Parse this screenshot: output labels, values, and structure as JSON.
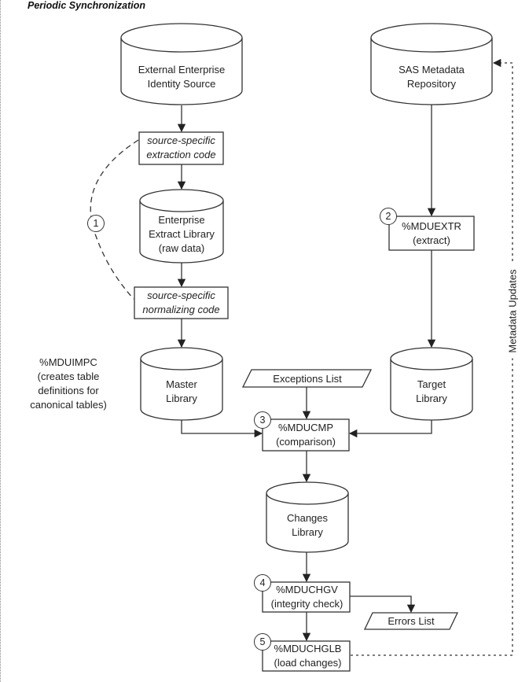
{
  "title": "Periodic Synchronization",
  "nodes": {
    "external_source": {
      "type": "database",
      "label": "External Enterprise\nIdentity Source"
    },
    "sas_repository": {
      "type": "database",
      "label": "SAS Metadata\nRepository"
    },
    "extraction_code": {
      "type": "process",
      "label": "source-specific\nextraction code",
      "style": "italic"
    },
    "extract_library": {
      "type": "database",
      "label": "Enterprise\nExtract Library\n(raw data)"
    },
    "normalizing_code": {
      "type": "process",
      "label": "source-specific\nnormalizing code",
      "style": "italic"
    },
    "mduextr": {
      "type": "process",
      "step": "2",
      "label": "%MDUEXTR\n(extract)"
    },
    "master_library": {
      "type": "database",
      "label": "Master\nLibrary"
    },
    "target_library": {
      "type": "database",
      "label": "Target\nLibrary"
    },
    "exceptions_list": {
      "type": "data",
      "label": "Exceptions List"
    },
    "mducmp": {
      "type": "process",
      "step": "3",
      "label": "%MDUCMP\n(comparison)"
    },
    "changes_library": {
      "type": "database",
      "label": "Changes\nLibrary"
    },
    "mduchgv": {
      "type": "process",
      "step": "4",
      "label": "%MDUCHGV\n(integrity check)"
    },
    "errors_list": {
      "type": "data",
      "label": "Errors List"
    },
    "mduchglb": {
      "type": "process",
      "step": "5",
      "label": "%MDUCHGLB\n(load changes)"
    }
  },
  "step1": {
    "step": "1",
    "annotation": "%MDUIMPC\n(creates table\ndefinitions for\ncanonical tables)"
  },
  "metadata_updates_label": "Metadata Updates",
  "edges": [
    {
      "from": "external_source",
      "to": "extraction_code"
    },
    {
      "from": "extraction_code",
      "to": "extract_library"
    },
    {
      "from": "extract_library",
      "to": "normalizing_code"
    },
    {
      "from": "normalizing_code",
      "to": "master_library"
    },
    {
      "from": "sas_repository",
      "to": "mduextr"
    },
    {
      "from": "mduextr",
      "to": "target_library"
    },
    {
      "from": "master_library",
      "to": "mducmp"
    },
    {
      "from": "target_library",
      "to": "mducmp"
    },
    {
      "from": "exceptions_list",
      "to": "mducmp"
    },
    {
      "from": "mducmp",
      "to": "changes_library"
    },
    {
      "from": "changes_library",
      "to": "mduchgv"
    },
    {
      "from": "mduchgv",
      "to": "errors_list"
    },
    {
      "from": "mduchgv",
      "to": "mduchglb"
    },
    {
      "from": "mduchglb",
      "to": "sas_repository",
      "style": "dotted",
      "label": "Metadata Updates"
    }
  ]
}
